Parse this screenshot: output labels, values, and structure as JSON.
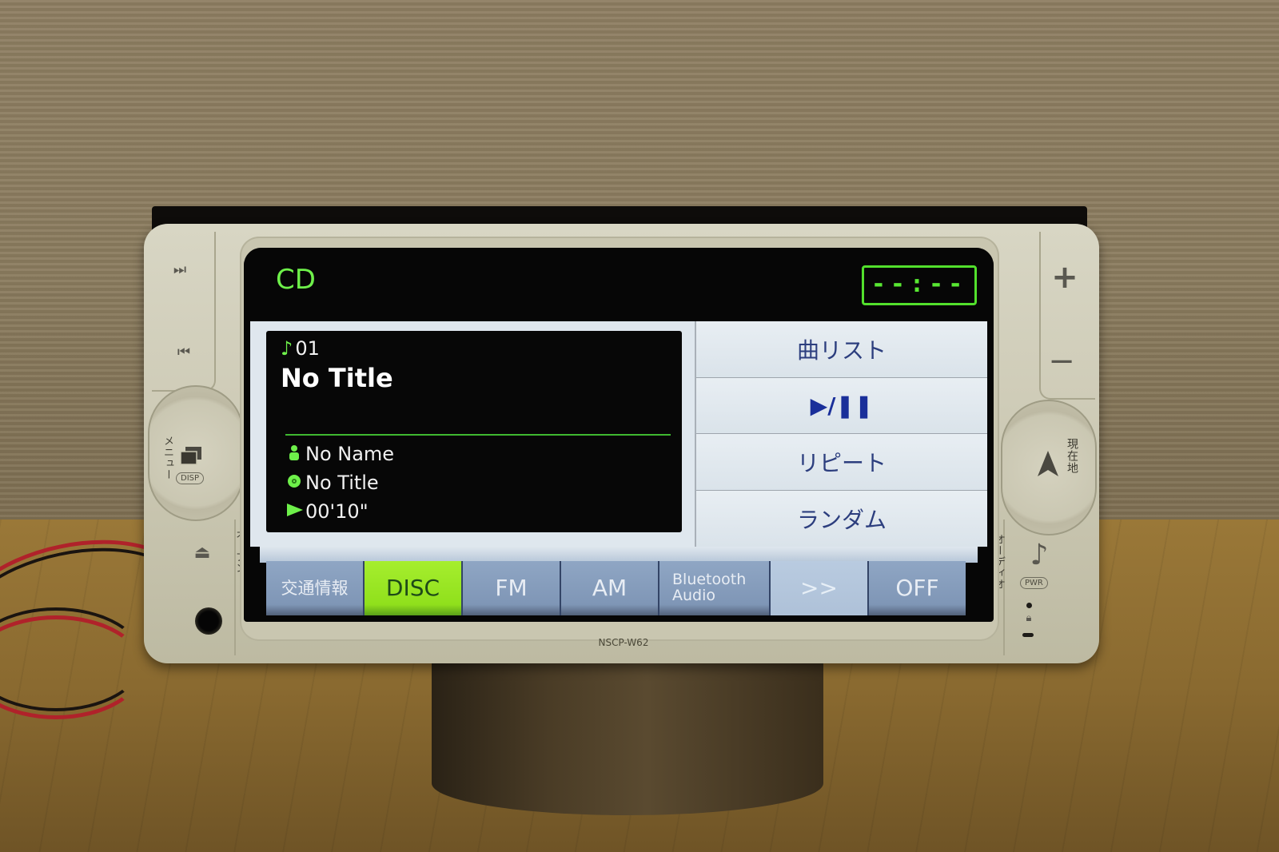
{
  "device": {
    "model": "NSCP-W62",
    "left_buttons": {
      "next_track_icon": "skip-forward-icon",
      "prev_track_icon": "skip-back-icon",
      "menu_label": "メニュー",
      "menu_pill": "DISP",
      "open_label": "オープン",
      "eject_icon": "eject-icon",
      "aux_jack": "aux-jack"
    },
    "right_buttons": {
      "volume_up": "+",
      "volume_down": "−",
      "current_location_label": "現在地",
      "audio_label": "オーディオ",
      "audio_pill": "PWR"
    }
  },
  "screen": {
    "source": "CD",
    "clock": "--:--",
    "now_playing": {
      "track_number": "01",
      "track_title": "No Title",
      "artist": "No Name",
      "album": "No Title",
      "elapsed": "00'10\""
    },
    "controls": [
      {
        "label": "曲リスト"
      },
      {
        "label": "▶/❚❚"
      },
      {
        "label": "リピート"
      },
      {
        "label": "ランダム"
      }
    ],
    "tabs": [
      {
        "label": "交通情報",
        "active": false
      },
      {
        "label": "DISC",
        "active": true
      },
      {
        "label": "FM",
        "active": false
      },
      {
        "label": "AM",
        "active": false
      },
      {
        "label_line1": "Bluetooth",
        "label_line2": "Audio",
        "active": false
      },
      {
        "label": ">>",
        "active": false
      },
      {
        "label": "OFF",
        "active": false
      }
    ]
  },
  "colors": {
    "accent_green": "#6ef04a",
    "active_tab": "#a6ee2e",
    "tab_blue": "#8fa6c4",
    "control_text": "#2c3e7e"
  }
}
